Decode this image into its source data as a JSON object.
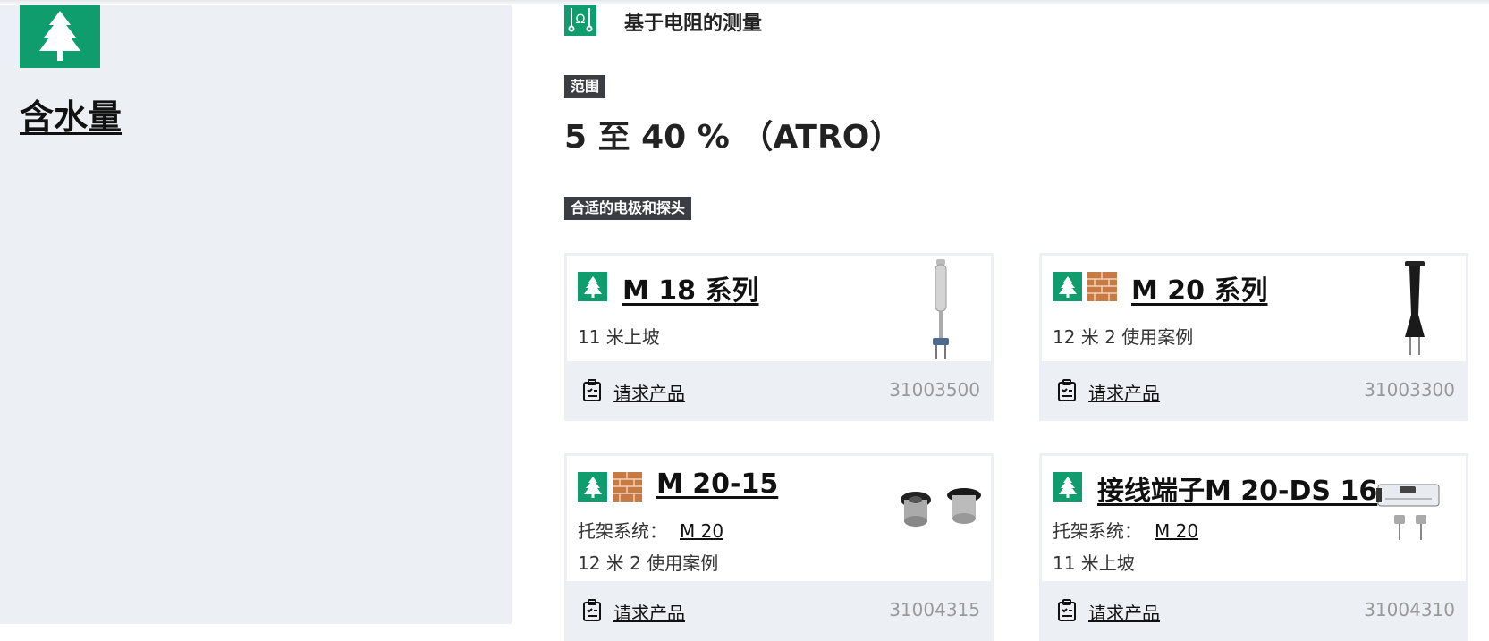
{
  "sidebar": {
    "title": "含水量",
    "category_icon": "tree-icon"
  },
  "method": {
    "label": "基于电阻的测量",
    "icon": "ohm-measurement-icon"
  },
  "range": {
    "badge": "范围",
    "value": "5 至 40 %  （ATRO）"
  },
  "probes": {
    "badge": "合适的电极和探头"
  },
  "cards": [
    {
      "title": "M 18 系列",
      "lines": [
        "11 米上坡"
      ],
      "request_label": "请求产品",
      "article_no": "31003500",
      "material_icons": [
        "tree-icon"
      ]
    },
    {
      "title": "M 20 系列",
      "lines": [
        "12 米  2 使用案例"
      ],
      "request_label": "请求产品",
      "article_no": "31003300",
      "material_icons": [
        "tree-icon",
        "brick-icon"
      ]
    },
    {
      "title": "M 20-15",
      "holder_label": "托架系统：",
      "holder_link": "M 20",
      "lines": [
        "12 米  2 使用案例"
      ],
      "request_label": "请求产品",
      "article_no": "31004315",
      "material_icons": [
        "tree-icon",
        "brick-icon"
      ]
    },
    {
      "title": "接线端子M 20-DS 16",
      "holder_label": "托架系统：",
      "holder_link": "M 20",
      "lines": [
        "11 米上坡"
      ],
      "request_label": "请求产品",
      "article_no": "31004310",
      "material_icons": [
        "tree-icon"
      ]
    }
  ],
  "colors": {
    "accent_green": "#0f9d6e",
    "brick": "#c77a44",
    "sidebar_bg": "#eceff3",
    "badge_bg": "#3a3d42"
  }
}
